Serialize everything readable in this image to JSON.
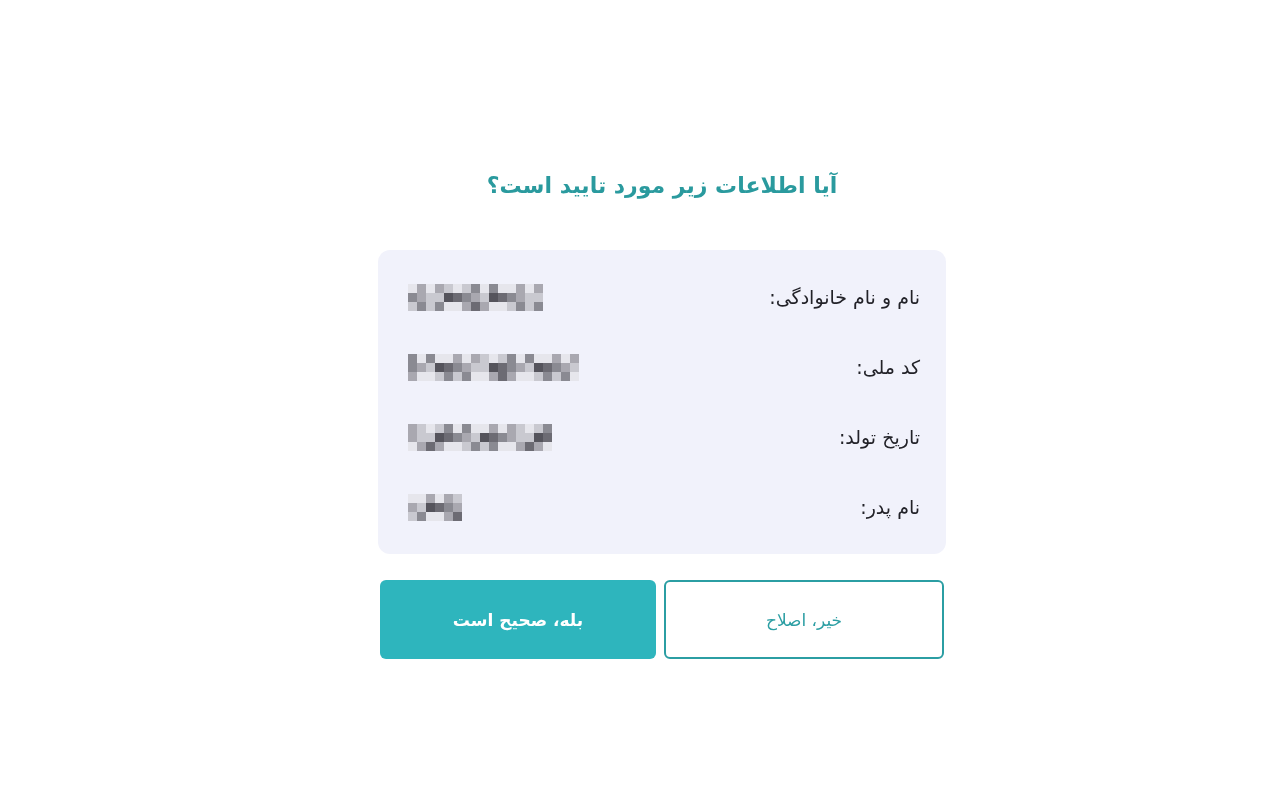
{
  "dialog": {
    "title": "آیا اطلاعات زیر مورد تایید است؟",
    "rows": [
      {
        "label": "نام و نام خانوادگی:",
        "value": {
          "kind": "pixelated"
        }
      },
      {
        "label": "کد ملی:",
        "value": {
          "kind": "pixelated"
        }
      },
      {
        "label": "تاریخ تولد:",
        "value": {
          "kind": "pixelated"
        }
      },
      {
        "label": "نام پدر:",
        "value": {
          "kind": "pixelated"
        }
      }
    ],
    "buttons": [
      {
        "label": "خیر، اصلاح",
        "kind": "outline"
      },
      {
        "label": "بله، صحیح است",
        "kind": "primary"
      }
    ]
  }
}
